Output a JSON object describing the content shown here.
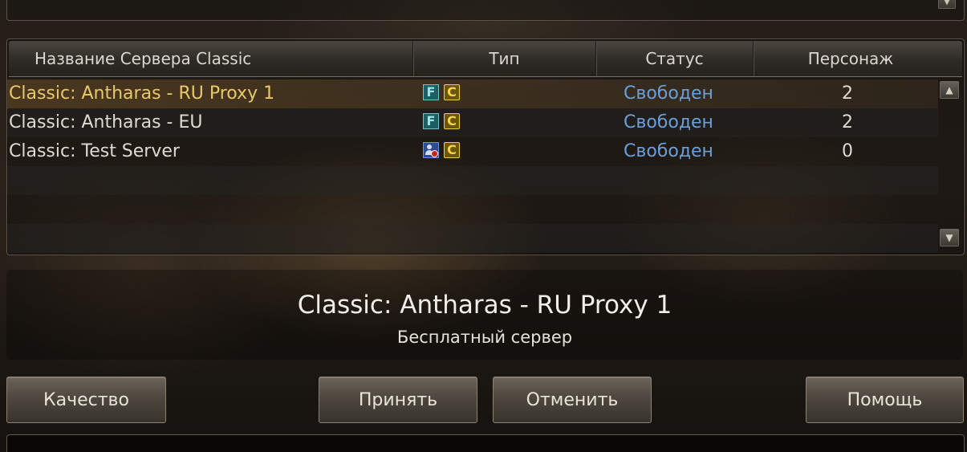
{
  "server_list": {
    "columns": {
      "name": "Название Сервера Classic",
      "type": "Тип",
      "status": "Статус",
      "characters": "Персонаж"
    },
    "rows": [
      {
        "name": "Classic: Antharas - RU Proxy 1",
        "types": [
          "F",
          "C"
        ],
        "status": "Свободен",
        "characters": "2",
        "selected": true
      },
      {
        "name": "Classic: Antharas - EU",
        "types": [
          "F",
          "C"
        ],
        "status": "Свободен",
        "characters": "2",
        "selected": false
      },
      {
        "name": "Classic: Test Server",
        "types": [
          "person-blocked-icon",
          "C"
        ],
        "status": "Свободен",
        "characters": "0",
        "selected": false
      }
    ]
  },
  "selected_info": {
    "title": "Classic: Antharas - RU Proxy 1",
    "subtitle": "Бесплатный сервер"
  },
  "buttons": {
    "quality": "Качество",
    "accept": "Принять",
    "cancel": "Отменить",
    "help": "Помощь"
  },
  "colors": {
    "selected_text": "#e8c96a",
    "status_text": "#6a9fd9",
    "badge_f": "#1d5e63",
    "badge_c": "#6b5610"
  }
}
